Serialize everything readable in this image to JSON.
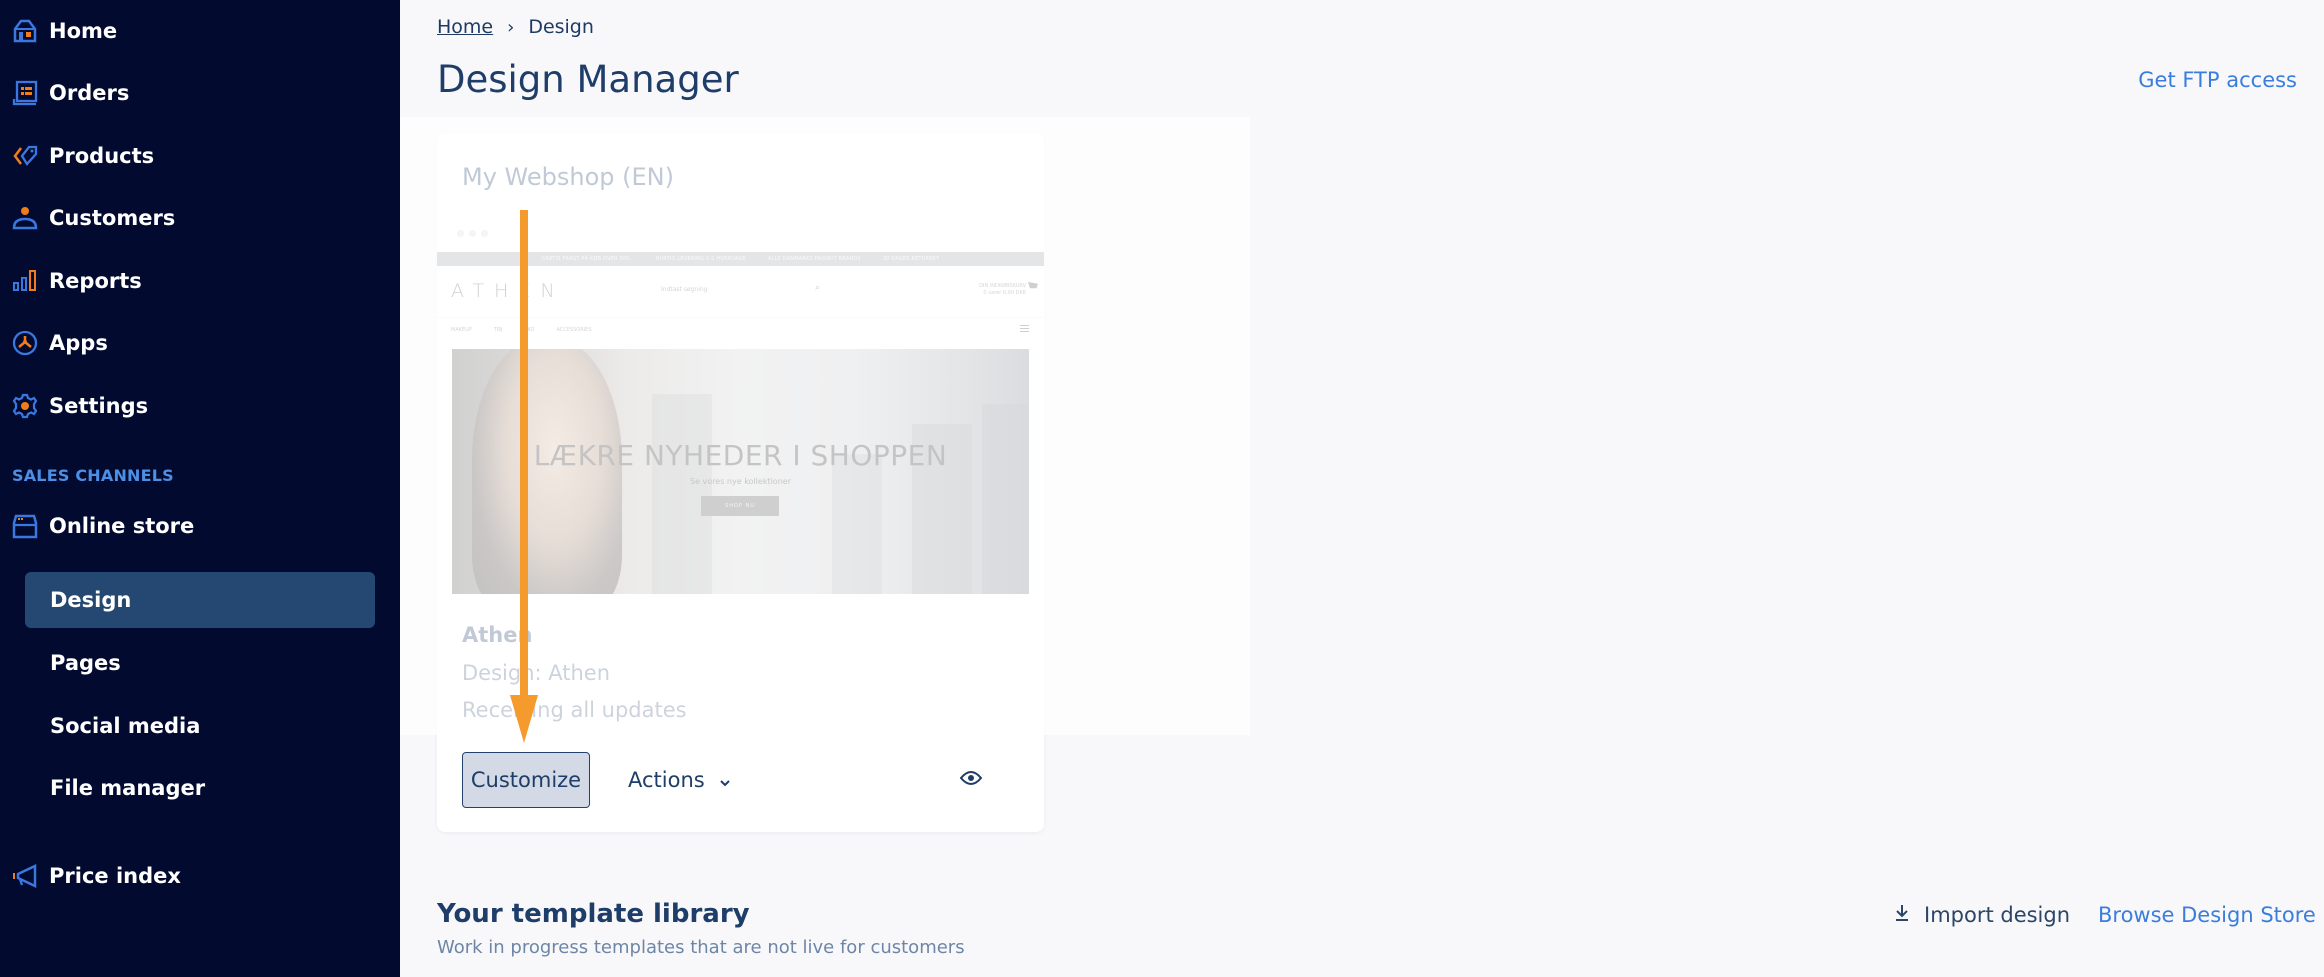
{
  "sidebar": {
    "items": [
      {
        "label": "Home",
        "icon": "home-icon"
      },
      {
        "label": "Orders",
        "icon": "orders-icon"
      },
      {
        "label": "Products",
        "icon": "tag-icon"
      },
      {
        "label": "Customers",
        "icon": "user-icon"
      },
      {
        "label": "Reports",
        "icon": "bar-chart-icon"
      },
      {
        "label": "Apps",
        "icon": "apps-icon"
      },
      {
        "label": "Settings",
        "icon": "gear-icon"
      }
    ],
    "section_label": "SALES CHANNELS",
    "online_store": {
      "label": "Online store",
      "icon": "store-icon"
    },
    "sub_items": [
      {
        "label": "Design",
        "active": true
      },
      {
        "label": "Pages",
        "active": false
      },
      {
        "label": "Social media",
        "active": false
      },
      {
        "label": "File manager",
        "active": false
      }
    ],
    "price_index": {
      "label": "Price index",
      "icon": "megaphone-icon"
    }
  },
  "breadcrumb": {
    "home": "Home",
    "separator": "›",
    "current": "Design"
  },
  "header": {
    "title": "Design Manager",
    "ftp_link": "Get FTP access"
  },
  "shop_card": {
    "title": "My Webshop (EN)",
    "preview": {
      "banner_items": [
        "GRATIS FRAGT PÅ KØB OVER 500,-",
        "HURTIG LEVERING 1-2 HVERDAGE",
        "ALLE DANMARKS FAVORIT BRANDS",
        "30 DAGES RETURRET"
      ],
      "logo": "ATHEN",
      "search_placeholder": "Indtast søgning",
      "cart_label": "DIN INDKØBSKURV",
      "cart_value": "0 varer 0,00 DKK",
      "nav": [
        "MAKEUP",
        "TØJ",
        "SKO",
        "ACCESSORIES"
      ],
      "hero_title": "LÆKRE NYHEDER I SHOPPEN",
      "hero_subtitle": "Se vores nye kollektioner",
      "hero_button": "SHOP NU"
    },
    "theme_name": "Athen",
    "design_line": "Design: Athen",
    "update_status": "Receiving all updates",
    "customize_label": "Customize",
    "actions_label": "Actions"
  },
  "template_library": {
    "title": "Your template library",
    "subtitle": "Work in progress templates that are not live for customers",
    "import_label": "Import design",
    "browse_label": "Browse Design Store"
  },
  "colors": {
    "sidebar_bg": "#020a2f",
    "active_item_bg": "#254872",
    "accent_blue": "#3b7ddd",
    "icon_orange": "#f07d1a",
    "annotation_arrow": "#f59a2c",
    "heading": "#1e3d68"
  }
}
